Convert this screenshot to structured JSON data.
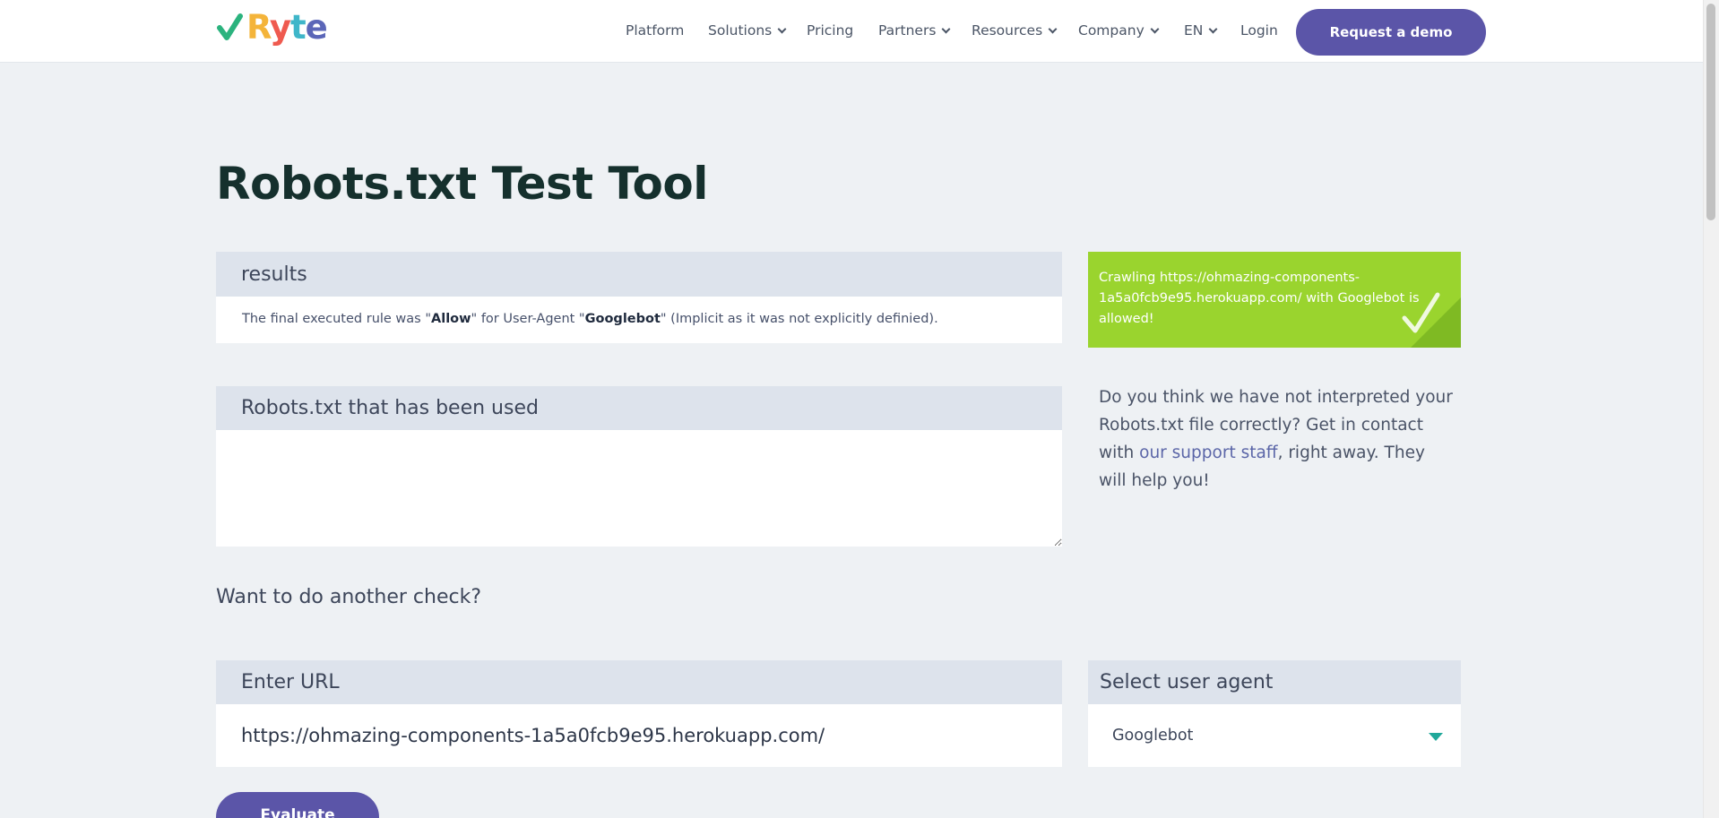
{
  "brand": {
    "logo_text": [
      "R",
      "y",
      "t",
      "e"
    ],
    "colors": {
      "check": "#2bb37e",
      "primary": "#5b55a8",
      "success": "#9ad42e",
      "title": "#15302d"
    }
  },
  "nav": {
    "items": [
      {
        "label": "Platform",
        "has_dropdown": false
      },
      {
        "label": "Solutions",
        "has_dropdown": true
      },
      {
        "label": "Pricing",
        "has_dropdown": false
      },
      {
        "label": "Partners",
        "has_dropdown": true
      },
      {
        "label": "Resources",
        "has_dropdown": true
      },
      {
        "label": "Company",
        "has_dropdown": true
      },
      {
        "label": "EN",
        "has_dropdown": true
      },
      {
        "label": "Login",
        "has_dropdown": false
      }
    ],
    "cta_label": "Request a demo"
  },
  "page": {
    "title": "Robots.txt Test Tool"
  },
  "results": {
    "heading": "results",
    "text_before": "The final executed rule was \"",
    "rule": "Allow",
    "text_middle": "\" for User-Agent \"",
    "agent": "Googlebot",
    "text_after": "\" (Implicit as it was not explicitly definied)."
  },
  "status": {
    "message": "Crawling https://ohmazing-components-1a5a0fcb9e95.herokuapp.com/ with Googlebot is allowed!",
    "icon": "checkmark-icon"
  },
  "robots_used": {
    "heading": "Robots.txt that has been used",
    "content": ""
  },
  "help": {
    "text_before": "Do you think we have not interpreted your Robots.txt file correctly? Get in contact with ",
    "link_label": "our support staff",
    "text_after": ", right away. They will help you!"
  },
  "another_check": {
    "heading": "Want to do another check?"
  },
  "url_form": {
    "label": "Enter URL",
    "value": "https://ohmazing-components-1a5a0fcb9e95.herokuapp.com/"
  },
  "agent_form": {
    "label": "Select user agent",
    "selected": "Googlebot"
  },
  "evaluate": {
    "label": "Evaluate"
  }
}
